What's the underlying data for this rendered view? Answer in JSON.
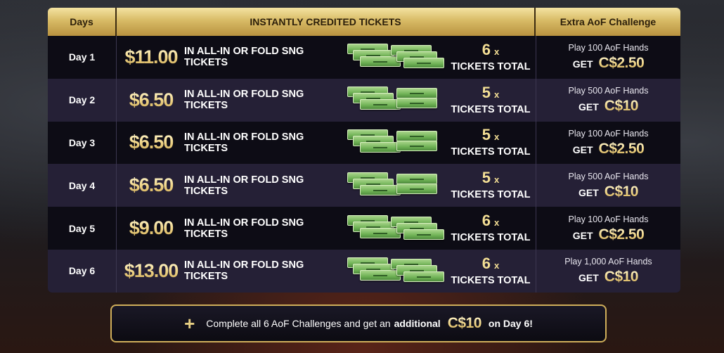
{
  "header": {
    "days": "Days",
    "tickets": "INSTANTLY CREDITED TICKETS",
    "challenge": "Extra AoF Challenge"
  },
  "rows": [
    {
      "day": "Day 1",
      "amount": "$11.00",
      "desc": "IN ALL-IN OR FOLD SNG TICKETS",
      "count": "6",
      "x": "x",
      "total": "TICKETS TOTAL",
      "play": "Play 100 AoF Hands",
      "get": "GET",
      "reward": "C$2.50"
    },
    {
      "day": "Day 2",
      "amount": "$6.50",
      "desc": "IN ALL-IN OR FOLD SNG TICKETS",
      "count": "5",
      "x": "x",
      "total": "TICKETS TOTAL",
      "play": "Play 500 AoF Hands",
      "get": "GET",
      "reward": "C$10"
    },
    {
      "day": "Day 3",
      "amount": "$6.50",
      "desc": "IN ALL-IN OR FOLD SNG TICKETS",
      "count": "5",
      "x": "x",
      "total": "TICKETS TOTAL",
      "play": "Play 100 AoF Hands",
      "get": "GET",
      "reward": "C$2.50"
    },
    {
      "day": "Day 4",
      "amount": "$6.50",
      "desc": "IN ALL-IN OR FOLD SNG TICKETS",
      "count": "5",
      "x": "x",
      "total": "TICKETS TOTAL",
      "play": "Play 500 AoF Hands",
      "get": "GET",
      "reward": "C$10"
    },
    {
      "day": "Day 5",
      "amount": "$9.00",
      "desc": "IN ALL-IN OR FOLD SNG TICKETS",
      "count": "6",
      "x": "x",
      "total": "TICKETS TOTAL",
      "play": "Play 100 AoF Hands",
      "get": "GET",
      "reward": "C$2.50"
    },
    {
      "day": "Day 6",
      "amount": "$13.00",
      "desc": "IN ALL-IN OR FOLD SNG TICKETS",
      "count": "6",
      "x": "x",
      "total": "TICKETS TOTAL",
      "play": "Play 1,000 AoF Hands",
      "get": "GET",
      "reward": "C$10"
    }
  ],
  "bonus": {
    "icon": "plus-icon",
    "text1": "Complete all 6 AoF Challenges and get an",
    "emph": "additional",
    "reward": "C$10",
    "text2": "on Day 6!"
  },
  "colors": {
    "gold": "#d8bb66",
    "ticket_green": "#6fb255",
    "row_dark": "#0d0c15",
    "row_light": "#252036"
  }
}
